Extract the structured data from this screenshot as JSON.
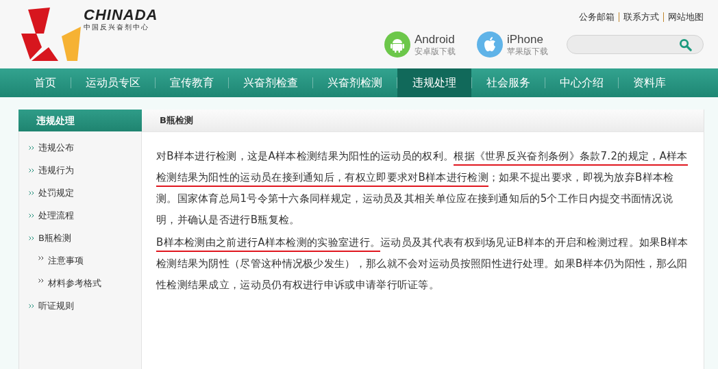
{
  "logo": {
    "wordmark": "CHINADA",
    "subtitle": "中国反兴奋剂中心"
  },
  "top_links": [
    "公务邮箱",
    "联系方式",
    "网站地图"
  ],
  "apps": [
    {
      "kind": "android",
      "name": "Android",
      "caption": "安卓版下载"
    },
    {
      "kind": "apple",
      "name": "iPhone",
      "caption": "苹果版下载"
    }
  ],
  "nav": [
    {
      "label": "首页",
      "selected": false
    },
    {
      "label": "运动员专区",
      "selected": false
    },
    {
      "label": "宣传教育",
      "selected": false
    },
    {
      "label": "兴奋剂检查",
      "selected": false
    },
    {
      "label": "兴奋剂检测",
      "selected": false
    },
    {
      "label": "违规处理",
      "selected": true
    },
    {
      "label": "社会服务",
      "selected": false
    },
    {
      "label": "中心介绍",
      "selected": false
    },
    {
      "label": "资料库",
      "selected": false
    }
  ],
  "sidebar": {
    "title": "违规处理",
    "items": [
      {
        "label": "违规公布"
      },
      {
        "label": "违规行为"
      },
      {
        "label": "处罚规定"
      },
      {
        "label": "处理流程"
      },
      {
        "label": "B瓶检测",
        "children": [
          {
            "label": "注意事项"
          },
          {
            "label": "材料参考格式"
          }
        ]
      },
      {
        "label": "听证规则"
      }
    ]
  },
  "content": {
    "title": "B瓶检测",
    "paragraphs": [
      [
        {
          "text": "对B样本进行检测，这是A样本检测结果为阳性的运动员的权利。",
          "underlined": false
        },
        {
          "text": "根据《世界反兴奋剂条例》条款7.2的规定，A样本检测结果为阳性的运动员在接到通知后，有权立即要求对B样本进行检测",
          "underlined": true
        },
        {
          "text": "；如果不提出要求，即视为放弃B样本检测。国家体育总局1号令第十六条同样规定，运动员及其相关单位应在接到通知后的5个工作日内提交书面情况说明，并确认是否进行B瓶复检。",
          "underlined": false
        }
      ],
      [
        {
          "text": "B样本检测由之前进行A样本检测的实验室进行。",
          "underlined": true
        },
        {
          "text": "运动员及其代表有权到场见证B样本的开启和检测过程。如果B样本检测结果为阴性（尽管这种情况极少发生），那么就不会对运动员按照阳性进行处理。如果B样本仍为阳性，那么阳性检测结果成立，运动员仍有权进行申诉或申请举行听证等。",
          "underlined": false
        }
      ]
    ]
  }
}
